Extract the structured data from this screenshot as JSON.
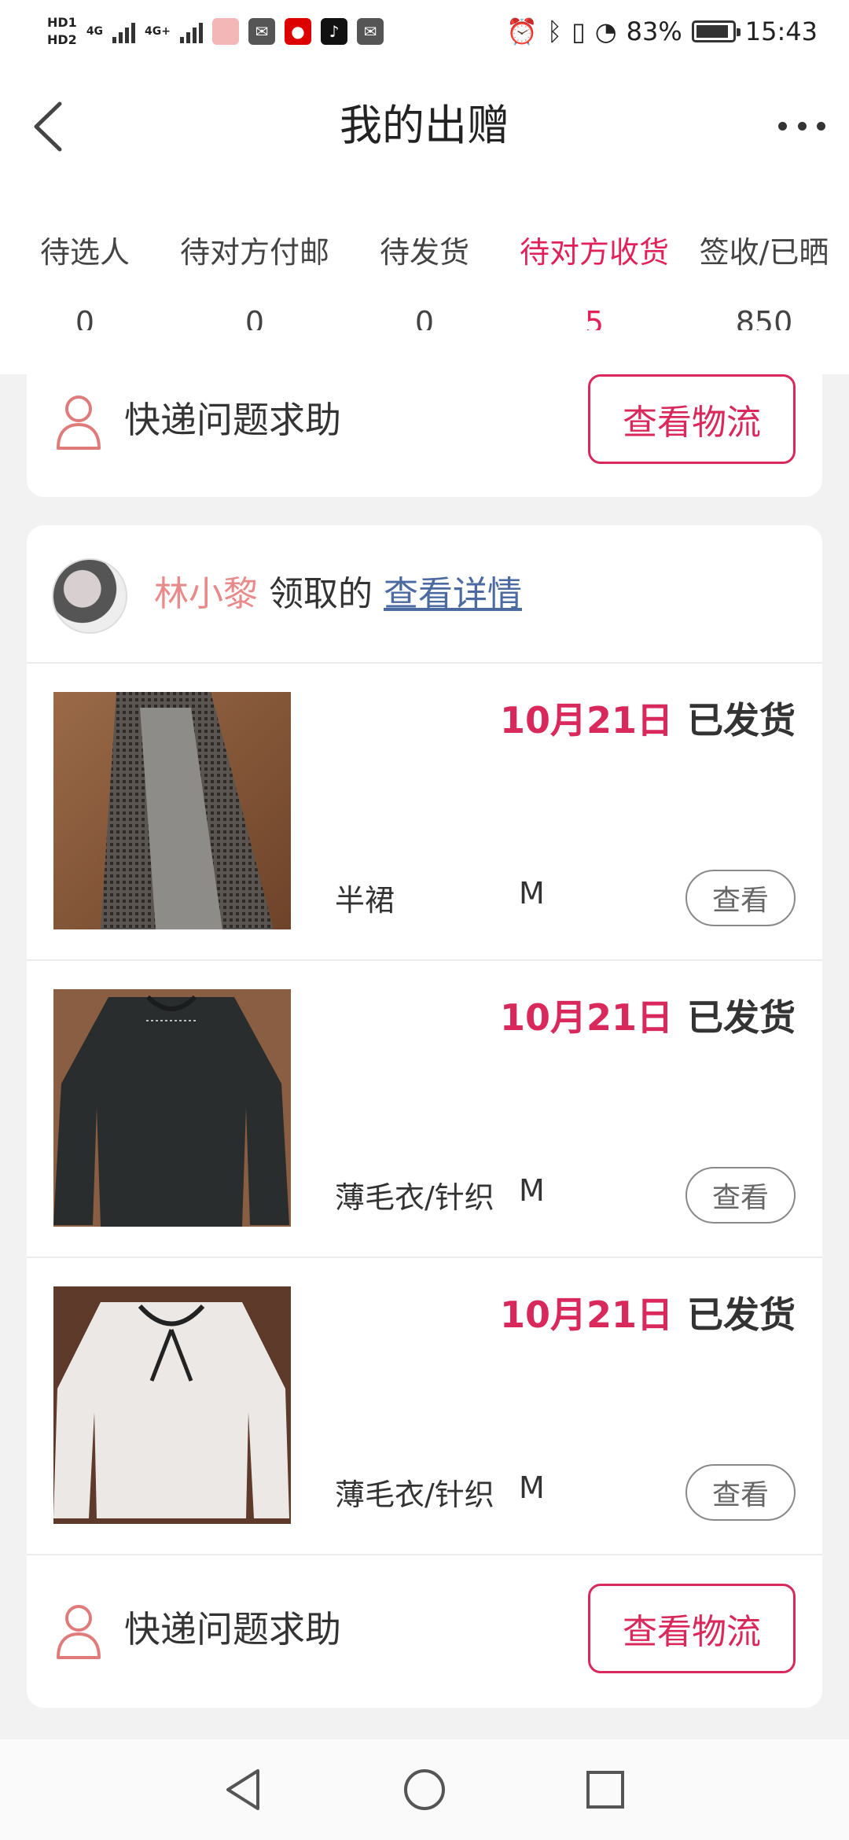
{
  "status_bar": {
    "hd1": "HD1",
    "hd2": "HD2",
    "net1": "4G",
    "net2": "4G+",
    "battery_pct": "83%",
    "time": "15:43"
  },
  "header": {
    "title": "我的出赠",
    "back_icon": "chevron-left-icon",
    "more_icon": "more-dots-icon"
  },
  "tabs": [
    {
      "label": "待选人",
      "count": "0"
    },
    {
      "label": "待对方付邮",
      "count": "0"
    },
    {
      "label": "待发货",
      "count": "0"
    },
    {
      "label": "待对方收货",
      "count": "5",
      "active": true
    },
    {
      "label": "签收/已晒",
      "count": "850"
    }
  ],
  "top_card": {
    "help_label": "快递问题求助",
    "logistics_button": "查看物流"
  },
  "order": {
    "receiver_name": "林小黎",
    "receiver_suffix": "领取的",
    "detail_link": "查看详情",
    "items": [
      {
        "date": "10月21日",
        "status": "已发货",
        "category": "半裙",
        "size": "M",
        "view": "查看"
      },
      {
        "date": "10月21日",
        "status": "已发货",
        "category": "薄毛衣/针织",
        "size": "M",
        "view": "查看"
      },
      {
        "date": "10月21日",
        "status": "已发货",
        "category": "薄毛衣/针织",
        "size": "M",
        "view": "查看"
      }
    ],
    "help_label": "快递问题求助",
    "logistics_button": "查看物流"
  },
  "colors": {
    "accent": "#e0215a",
    "receiver_name": "#e88a8a",
    "link": "#4a6aa0"
  }
}
